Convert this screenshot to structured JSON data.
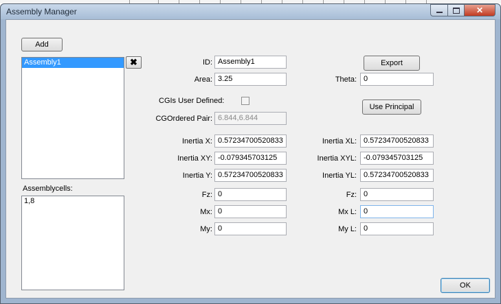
{
  "window": {
    "title": "Assembly Manager",
    "close_glyph": "✕"
  },
  "buttons": {
    "add": "Add",
    "export": "Export",
    "use_principal": "Use Principal",
    "ok": "OK",
    "delete_glyph": "✖"
  },
  "assemblies": {
    "items": [
      "Assembly1"
    ],
    "selected_index": 0
  },
  "assemblycells": {
    "label": "Assemblycells:",
    "items": [
      "1,8"
    ]
  },
  "fields": {
    "id": {
      "label": "ID:",
      "value": "Assembly1"
    },
    "area": {
      "label": "Area:",
      "value": "3.25"
    },
    "theta": {
      "label": "Theta:",
      "value": "0"
    },
    "cgis_user_defined": {
      "label": "CGIs User Defined:",
      "checked": false
    },
    "cg_ordered_pair": {
      "label": "CGOrdered Pair:",
      "value": "6.844,6.844"
    },
    "inertia_x": {
      "label": "Inertia X:",
      "value": "0.57234700520833"
    },
    "inertia_xy": {
      "label": "Inertia XY:",
      "value": "-0.079345703125"
    },
    "inertia_y": {
      "label": "Inertia Y:",
      "value": "0.57234700520833"
    },
    "fz": {
      "label": "Fz:",
      "value": "0"
    },
    "mx": {
      "label": "Mx:",
      "value": "0"
    },
    "my": {
      "label": "My:",
      "value": "0"
    },
    "inertia_xl": {
      "label": "Inertia XL:",
      "value": "0.57234700520833"
    },
    "inertia_xyl": {
      "label": "Inertia XYL:",
      "value": "-0.079345703125"
    },
    "inertia_yl": {
      "label": "Inertia YL:",
      "value": "0.57234700520833"
    },
    "fz_right": {
      "label": "Fz:",
      "value": "0"
    },
    "mxl": {
      "label": "Mx L:",
      "value": "0"
    },
    "myl": {
      "label": "My L:",
      "value": "0"
    }
  }
}
